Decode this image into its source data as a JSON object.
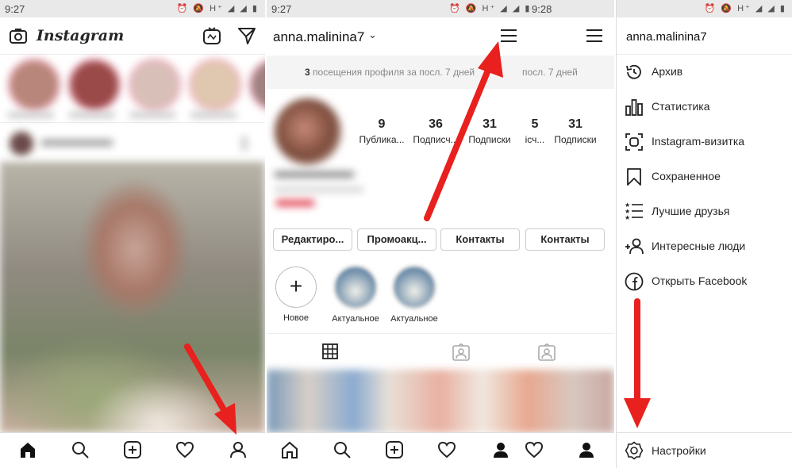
{
  "panel1": {
    "status_time": "9:27",
    "status_icons": "⏰ 🔕 H⁺ ◢ ◢ ▮",
    "app_name": "Instagram"
  },
  "panel2": {
    "status_time": "9:27",
    "status_icons": "⏰ 🔕 H⁺ ◢ ◢ ▮",
    "username": "anna.malinina7",
    "visits_count": "3",
    "visits_text": "посещения профиля за посл. 7 дней",
    "visits_text_partial": "посл. 7 дней",
    "stats": [
      {
        "value": "9",
        "label": "Публика..."
      },
      {
        "value": "36",
        "label": "Подписч..."
      },
      {
        "value": "31",
        "label": "Подписки"
      }
    ],
    "stats_right": [
      {
        "value": "5",
        "label": "ісч..."
      },
      {
        "value": "31",
        "label": "Подписки"
      }
    ],
    "buttons": [
      "Редактиро...",
      "Промоакц...",
      "Контакты"
    ],
    "button_right": "Контакты",
    "highlights": [
      {
        "label": "Новое",
        "glyph": "+"
      },
      {
        "label": "Актуальное"
      },
      {
        "label": "Актуальное"
      }
    ]
  },
  "panel3": {
    "status_time": "9:28",
    "status_icons": "⏰ 🔕 H⁺ ◢ ◢ ▮",
    "username": "anna.malinina7",
    "menu": [
      {
        "label": "Архив",
        "icon": "archive-icon"
      },
      {
        "label": "Статистика",
        "icon": "stats-icon"
      },
      {
        "label": "Instagram-визитка",
        "icon": "nametag-icon"
      },
      {
        "label": "Сохраненное",
        "icon": "bookmark-icon"
      },
      {
        "label": "Лучшие друзья",
        "icon": "close-friends-icon"
      },
      {
        "label": "Интересные люди",
        "icon": "add-person-icon"
      },
      {
        "label": "Открыть Facebook",
        "icon": "facebook-icon"
      }
    ],
    "settings": "Настройки"
  },
  "colors": {
    "arrow": "#e8201e",
    "statusbar": "#e9e9e9",
    "text": "#262626"
  }
}
